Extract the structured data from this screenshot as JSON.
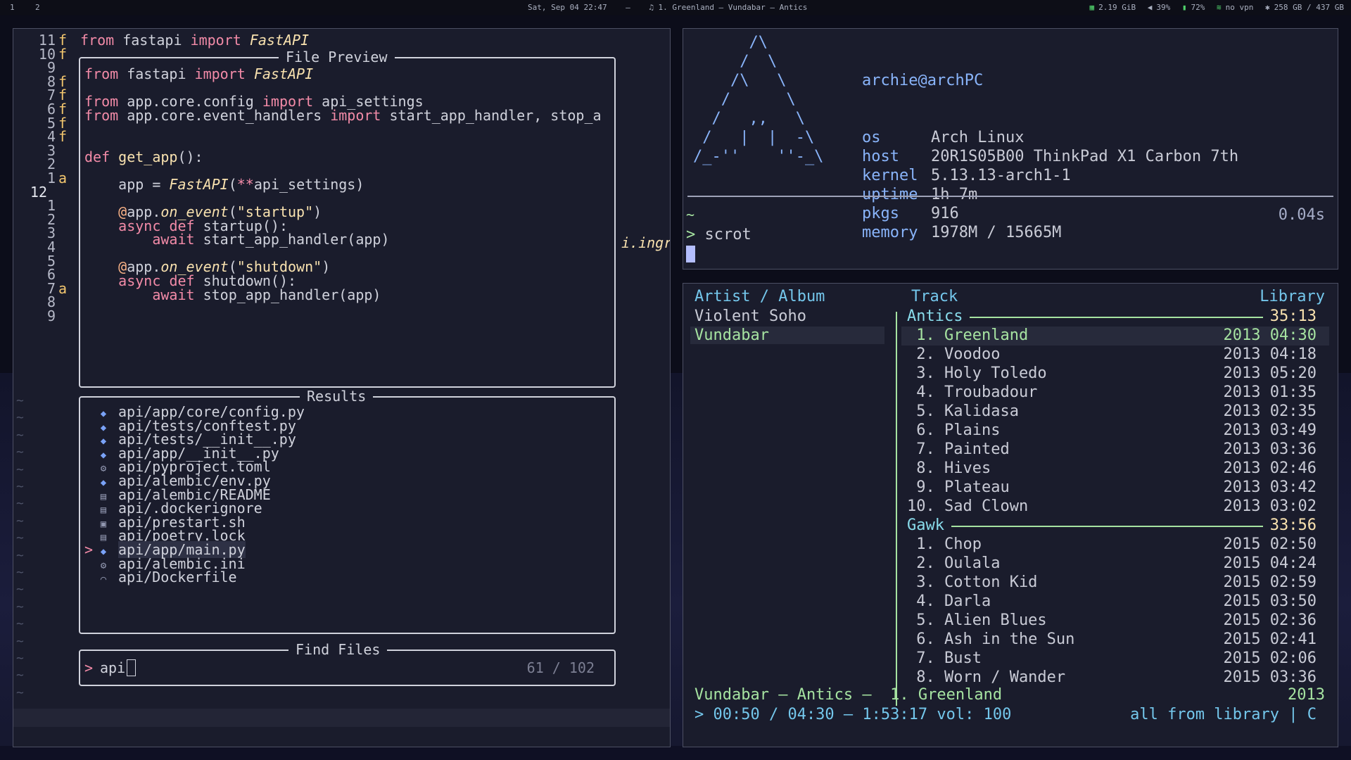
{
  "topbar": {
    "workspaces": [
      "1",
      "2"
    ],
    "datetime": "Sat, Sep 04 22:47",
    "dash": "–",
    "now_playing_icon": "♫",
    "now_playing": "1. Greenland – Vundabar – Antics",
    "memory": "2.19 GiB",
    "volume": "39%",
    "battery": "72%",
    "vpn": "no vpn",
    "disk": "258 GB / 437 GB"
  },
  "editor": {
    "line_numbers": [
      "11",
      "10",
      "9",
      "8",
      "7",
      "6",
      "5",
      "4",
      "3",
      "2",
      "1",
      "12",
      "1",
      "2",
      "3",
      "4",
      "5",
      "6",
      "7",
      "8",
      "9"
    ],
    "gutter": [
      "f",
      "f",
      "",
      "f",
      "f",
      "f",
      "f",
      "f",
      "",
      "",
      "a",
      "",
      "",
      "",
      "",
      "",
      "",
      "",
      "a",
      "",
      ""
    ],
    "background_line_1": "from fastapi import FastAPI",
    "background_fragment": "i.ingre",
    "preview": {
      "title": "File Preview",
      "lines": [
        "from fastapi import FastAPI",
        "",
        "from app.core.config import api_settings",
        "from app.core.event_handlers import start_app_handler, stop_a",
        "",
        "",
        "def get_app():",
        "",
        "    app = FastAPI(**api_settings)",
        "",
        "    @app.on_event(\"startup\")",
        "    async def startup():",
        "        await start_app_handler(app)",
        "",
        "    @app.on_event(\"shutdown\")",
        "    async def shutdown():",
        "        await stop_app_handler(app)"
      ]
    },
    "results": {
      "title": "Results",
      "items": [
        {
          "path": "api/app/core/config.py",
          "icon": "python-icon"
        },
        {
          "path": "api/tests/conftest.py",
          "icon": "python-icon"
        },
        {
          "path": "api/tests/__init__.py",
          "icon": "python-icon"
        },
        {
          "path": "api/app/__init__.py",
          "icon": "python-icon"
        },
        {
          "path": "api/pyproject.toml",
          "icon": "gear-icon"
        },
        {
          "path": "api/alembic/env.py",
          "icon": "python-icon"
        },
        {
          "path": "api/alembic/README",
          "icon": "file-icon"
        },
        {
          "path": "api/.dockerignore",
          "icon": "file-icon"
        },
        {
          "path": "api/prestart.sh",
          "icon": "terminal-icon"
        },
        {
          "path": "api/poetry.lock",
          "icon": "file-icon"
        },
        {
          "path": "api/app/main.py",
          "icon": "python-icon",
          "selected": true
        },
        {
          "path": "api/alembic.ini",
          "icon": "gear-icon"
        },
        {
          "path": "api/Dockerfile",
          "icon": "docker-icon"
        }
      ]
    },
    "find": {
      "title": "Find Files",
      "prompt": ">",
      "query": "api",
      "count": "61 / 102"
    }
  },
  "terminal": {
    "ascii_logo": "arch-logo",
    "user_host": "archie@archPC",
    "fetch": [
      {
        "key": "os",
        "value": "Arch Linux"
      },
      {
        "key": "host",
        "value": "20R1S05B00 ThinkPad X1 Carbon 7th"
      },
      {
        "key": "kernel",
        "value": "5.13.13-arch1-1"
      },
      {
        "key": "uptime",
        "value": "1h 7m"
      },
      {
        "key": "pkgs",
        "value": "916"
      },
      {
        "key": "memory",
        "value": "1978M / 15665M"
      }
    ],
    "cwd": "~",
    "duration": "0.04s",
    "prompt": ">",
    "command": "scrot"
  },
  "music": {
    "headers": {
      "artist_album": "Artist / Album",
      "track": "Track",
      "library": "Library"
    },
    "artists": [
      {
        "name": "Violent Soho"
      },
      {
        "name": "Vundabar",
        "selected": true
      }
    ],
    "albums": [
      {
        "title": "Antics",
        "duration": "35:13",
        "tracks": [
          {
            "no": " 1.",
            "title": "Greenland",
            "year": "2013",
            "len": "04:30",
            "playing": true
          },
          {
            "no": " 2.",
            "title": "Voodoo",
            "year": "2013",
            "len": "04:18"
          },
          {
            "no": " 3.",
            "title": "Holy Toledo",
            "year": "2013",
            "len": "05:20"
          },
          {
            "no": " 4.",
            "title": "Troubadour",
            "year": "2013",
            "len": "01:35"
          },
          {
            "no": " 5.",
            "title": "Kalidasa",
            "year": "2013",
            "len": "02:35"
          },
          {
            "no": " 6.",
            "title": "Plains",
            "year": "2013",
            "len": "03:49"
          },
          {
            "no": " 7.",
            "title": "Painted",
            "year": "2013",
            "len": "03:36"
          },
          {
            "no": " 8.",
            "title": "Hives",
            "year": "2013",
            "len": "02:46"
          },
          {
            "no": " 9.",
            "title": "Plateau",
            "year": "2013",
            "len": "03:42"
          },
          {
            "no": "10.",
            "title": "Sad Clown",
            "year": "2013",
            "len": "03:02"
          }
        ]
      },
      {
        "title": "Gawk",
        "duration": "33:56",
        "tracks": [
          {
            "no": " 1.",
            "title": "Chop",
            "year": "2015",
            "len": "02:50"
          },
          {
            "no": " 2.",
            "title": "Oulala",
            "year": "2015",
            "len": "04:24"
          },
          {
            "no": " 3.",
            "title": "Cotton Kid",
            "year": "2015",
            "len": "02:59"
          },
          {
            "no": " 4.",
            "title": "Darla",
            "year": "2015",
            "len": "03:50"
          },
          {
            "no": " 5.",
            "title": "Alien Blues",
            "year": "2015",
            "len": "02:36"
          },
          {
            "no": " 6.",
            "title": "Ash in the Sun",
            "year": "2015",
            "len": "02:41"
          },
          {
            "no": " 7.",
            "title": "Bust",
            "year": "2015",
            "len": "02:06"
          },
          {
            "no": " 8.",
            "title": "Worn / Wander",
            "year": "2015",
            "len": "03:36"
          }
        ]
      }
    ],
    "status": {
      "now": "Vundabar – Antics –  1. Greenland",
      "year": "2013",
      "progress": "> 00:50 / 04:30 – 1:53:17 vol: 100",
      "mode": "all from library | C"
    }
  },
  "colors": {
    "accent_green": "#a6e3a1",
    "accent_cyan": "#74c7ec",
    "accent_blue": "#89b4fa",
    "keyword": "#f38ba8",
    "function": "#f9e2af"
  }
}
